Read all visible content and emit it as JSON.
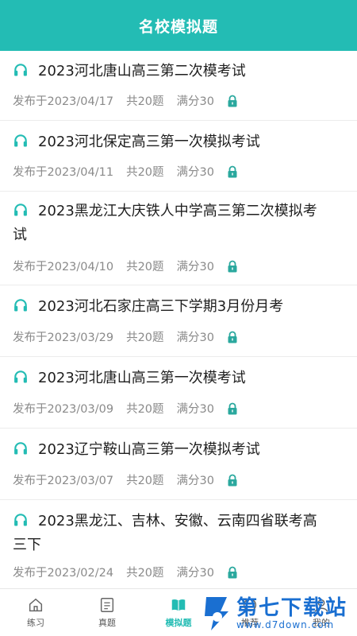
{
  "header": {
    "title": "名校模拟题"
  },
  "exams": [
    {
      "title": "2023河北唐山高三第二次模考试",
      "date": "发布于2023/04/17",
      "count": "共20题",
      "score": "满分30"
    },
    {
      "title": "2023河北保定高三第一次模拟考试",
      "date": "发布于2023/04/11",
      "count": "共20题",
      "score": "满分30"
    },
    {
      "title_line1": "2023黑龙江大庆铁人中学高三第二次模拟考",
      "title_line2": "试",
      "date": "发布于2023/04/10",
      "count": "共20题",
      "score": "满分30"
    },
    {
      "title": "2023河北石家庄高三下学期3月份月考",
      "date": "发布于2023/03/29",
      "count": "共20题",
      "score": "满分30"
    },
    {
      "title": "2023河北唐山高三第一次模考试",
      "date": "发布于2023/03/09",
      "count": "共20题",
      "score": "满分30"
    },
    {
      "title": "2023辽宁鞍山高三第一次模拟考试",
      "date": "发布于2023/03/07",
      "count": "共20题",
      "score": "满分30"
    },
    {
      "title_line1": "2023黑龙江、吉林、安徽、云南四省联考高",
      "title_line2": "三下",
      "date": "发布于2023/02/24",
      "count": "共20题",
      "score": "满分30"
    }
  ],
  "tabs": [
    {
      "label": "练习",
      "icon": "home-icon"
    },
    {
      "label": "真题",
      "icon": "exam-paper-icon"
    },
    {
      "label": "模拟题",
      "icon": "book-icon",
      "active": true
    },
    {
      "label": "推荐",
      "icon": "recommend-icon"
    },
    {
      "label": "我的",
      "icon": "profile-icon"
    }
  ],
  "watermark": {
    "name": "第七下载站",
    "url": "www.d7down.com"
  },
  "colors": {
    "accent": "#23bcb4",
    "lock": "#2aa89e",
    "watermark": "#1a6fd1"
  }
}
